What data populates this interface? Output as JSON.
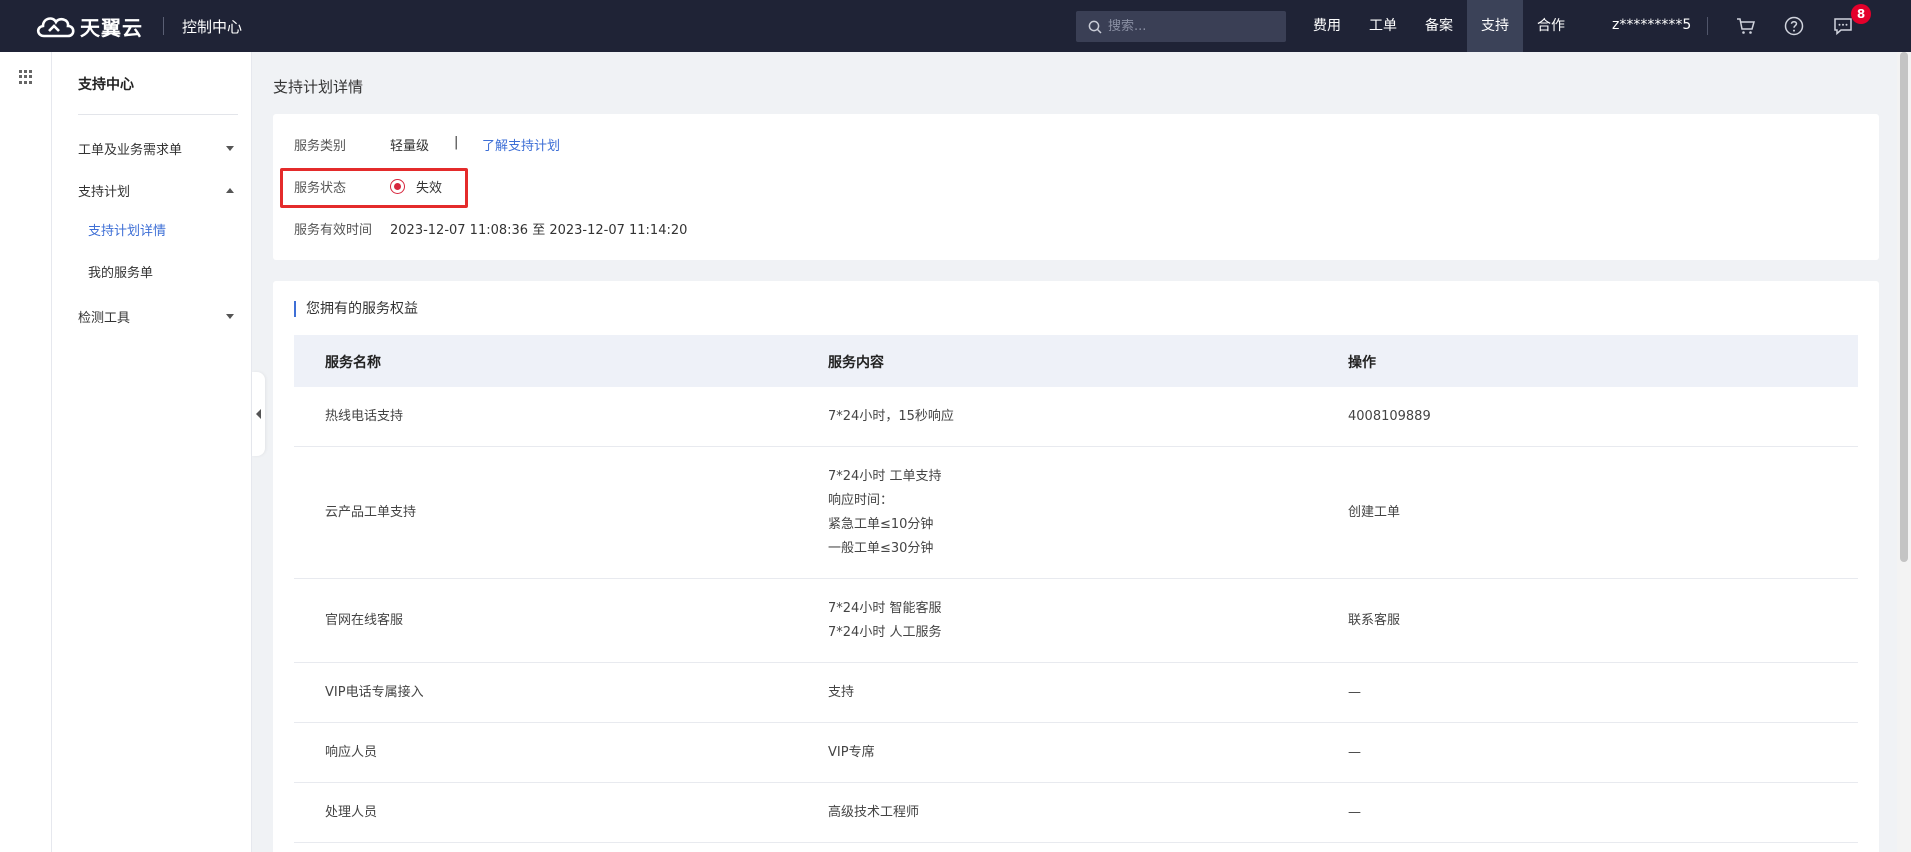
{
  "header": {
    "brand": "天翼云",
    "console": "控制中心",
    "search_placeholder": "搜索...",
    "nav": [
      "费用",
      "工单",
      "备案",
      "支持",
      "合作"
    ],
    "active_nav": "支持",
    "user": "z*********5",
    "message_count": "8"
  },
  "sidebar": {
    "title": "支持中心",
    "items": [
      {
        "label": "工单及业务需求单"
      },
      {
        "label": "支持计划"
      },
      {
        "label": "支持计划详情"
      },
      {
        "label": "我的服务单"
      },
      {
        "label": "检测工具"
      }
    ]
  },
  "page": {
    "title": "支持计划详情"
  },
  "plan": {
    "type_label": "服务类别",
    "type_value": "轻量级",
    "pipe": "|",
    "learn_link": "了解支持计划",
    "status_label": "服务状态",
    "status_value": "失效",
    "time_label": "服务有效时间",
    "time_value": "2023-12-07 11:08:36 至 2023-12-07 11:14:20"
  },
  "benefits": {
    "title": "您拥有的服务权益",
    "columns": [
      "服务名称",
      "服务内容",
      "操作"
    ],
    "rows": [
      {
        "name": "热线电话支持",
        "content": [
          "7*24小时，15秒响应"
        ],
        "action": "4008109889"
      },
      {
        "name": "云产品工单支持",
        "content": [
          "7*24小时 工单支持",
          "响应时间：",
          "紧急工单≤10分钟",
          "一般工单≤30分钟"
        ],
        "action": "创建工单"
      },
      {
        "name": "官网在线客服",
        "content": [
          "7*24小时 智能客服",
          "7*24小时 人工服务"
        ],
        "action": "联系客服"
      },
      {
        "name": "VIP电话专属接入",
        "content": [
          "支持"
        ],
        "action": "—"
      },
      {
        "name": "响应人员",
        "content": [
          "VIP专席"
        ],
        "action": "—"
      },
      {
        "name": "处理人员",
        "content": [
          "高级技术工程师"
        ],
        "action": "—"
      }
    ]
  },
  "colors": {
    "topbar": "#1f2336",
    "link": "#3e6fd6",
    "highlight": "#e42b2b",
    "status": "#d7263d",
    "badge": "#e4002b"
  }
}
